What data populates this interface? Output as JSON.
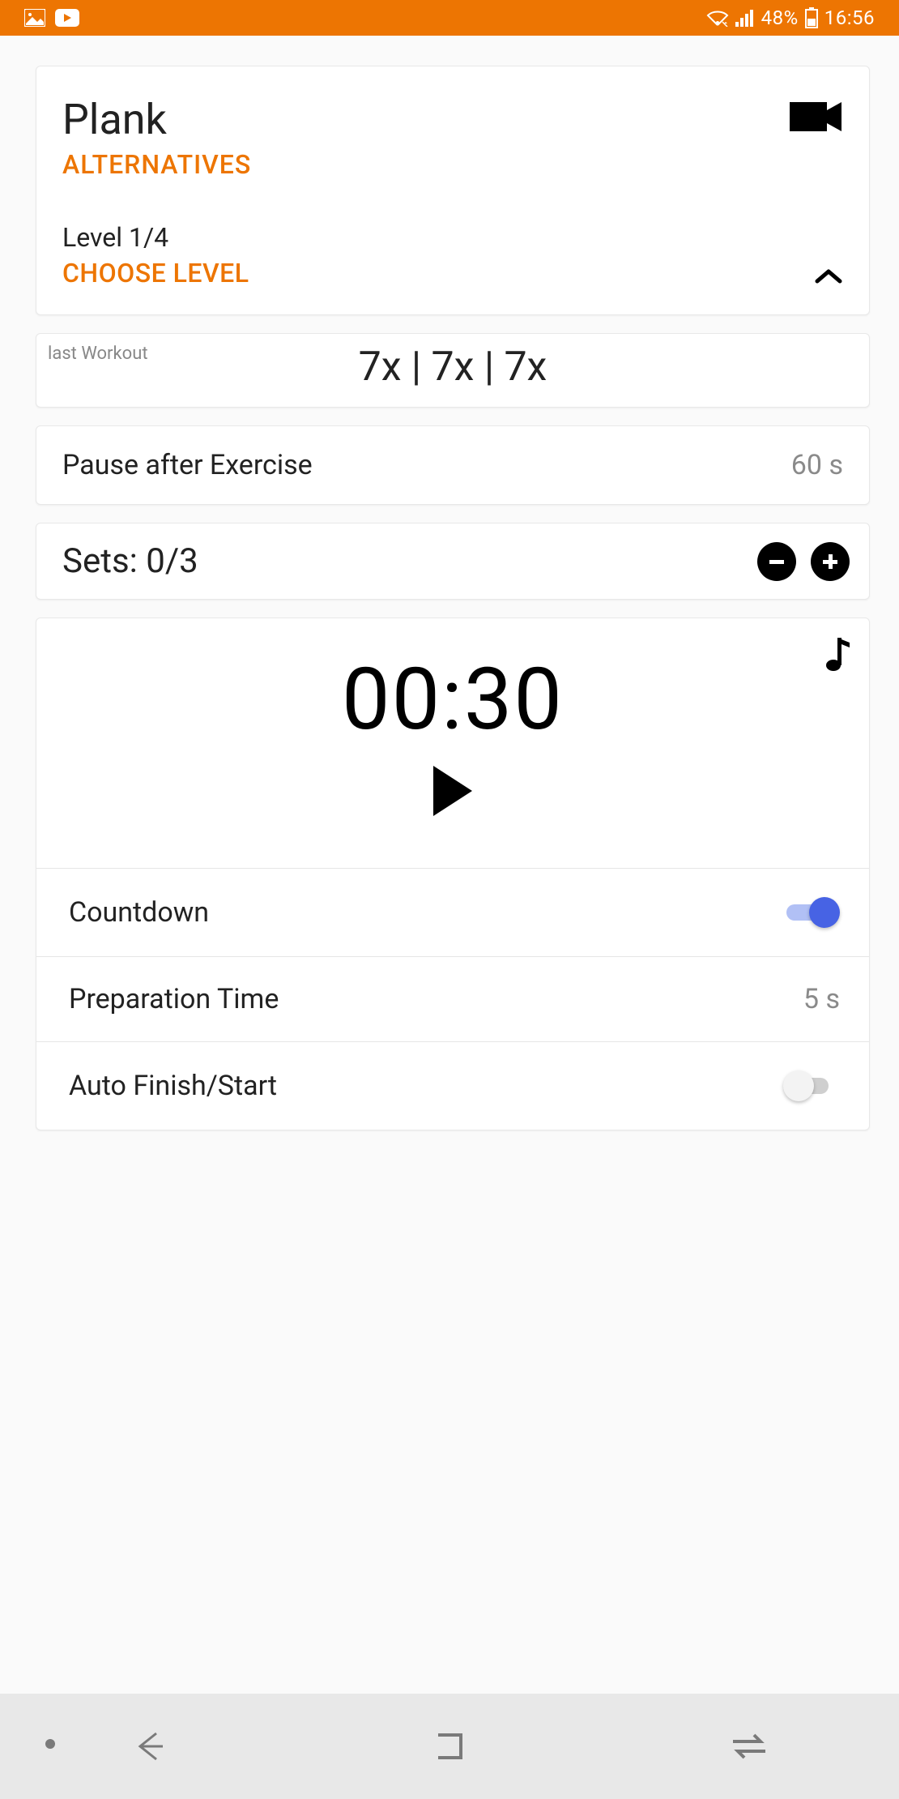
{
  "status": {
    "battery": "48%",
    "time": "16:56"
  },
  "exercise": {
    "name": "Plank",
    "alternatives_label": "ALTERNATIVES",
    "level_text": "Level 1/4",
    "choose_level_label": "CHOOSE LEVEL"
  },
  "last_workout": {
    "label": "last Workout",
    "values": "7x | 7x | 7x"
  },
  "pause": {
    "label": "Pause after Exercise",
    "value": "60 s"
  },
  "sets": {
    "label": "Sets: 0/3"
  },
  "timer": {
    "display": "00:30"
  },
  "settings": {
    "countdown": {
      "label": "Countdown",
      "on": true
    },
    "prep_time": {
      "label": "Preparation Time",
      "value": "5 s"
    },
    "auto_finish": {
      "label": "Auto Finish/Start",
      "on": false
    }
  },
  "colors": {
    "accent": "#ed7502",
    "toggle_on": "#4763e4"
  }
}
